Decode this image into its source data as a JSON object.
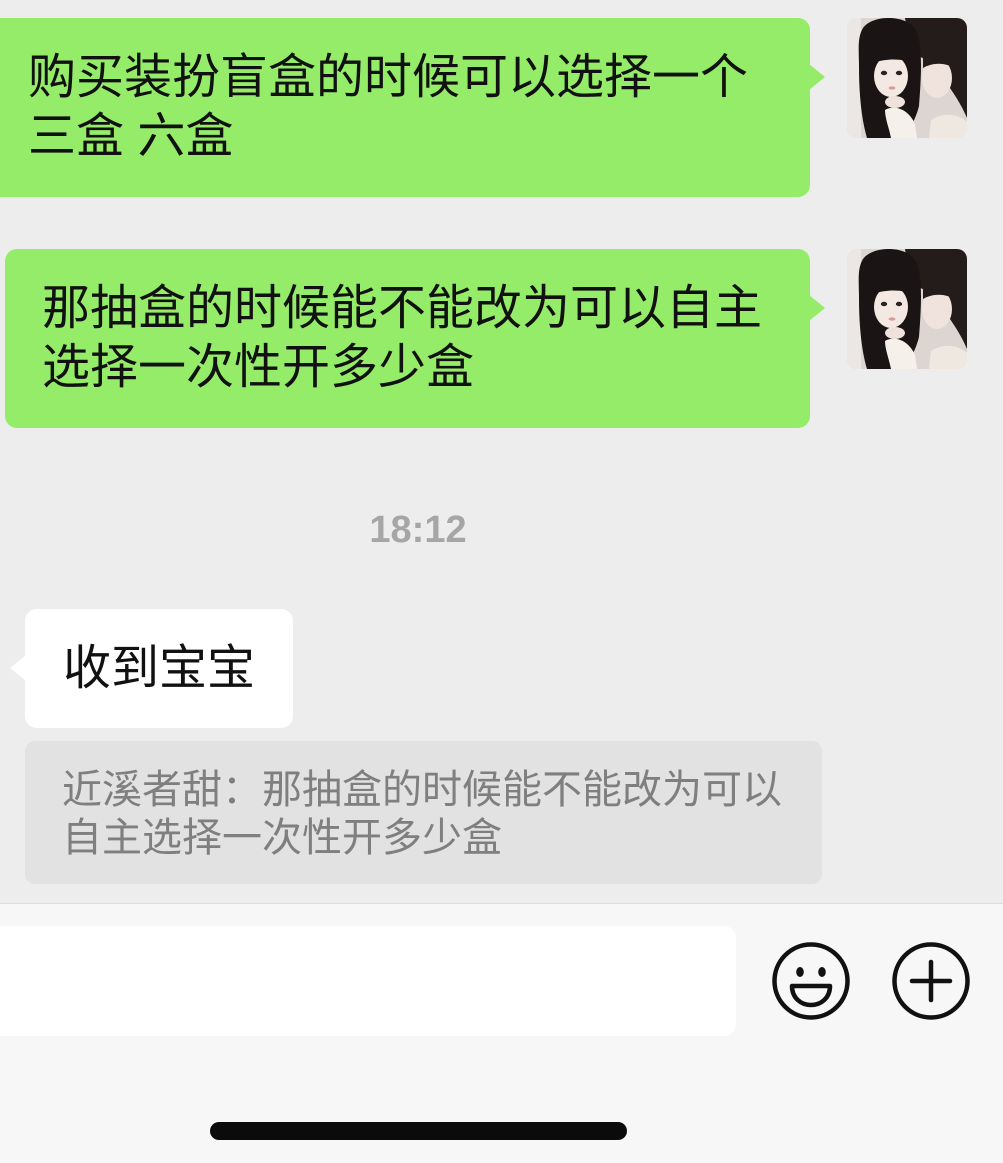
{
  "chat": {
    "sent_messages": [
      {
        "text": "购买装扮盲盒的时候可以选择一个三盒 六盒"
      },
      {
        "text": "那抽盒的时候能不能改为可以自主选择一次性开多少盒"
      }
    ],
    "timestamp": "18:12",
    "received_messages": [
      {
        "text": "收到宝宝",
        "quote": "近溪者甜：那抽盒的时候能不能改为可以自主选择一次性开多少盒"
      }
    ]
  },
  "input_bar": {
    "value": "",
    "emoji_icon": "smiley-face-icon",
    "more_icon": "plus-circle-icon"
  },
  "colors": {
    "chat_bg": "#ededed",
    "sent_bubble": "#95ec69",
    "received_bubble": "#ffffff",
    "quote_bg": "#e2e2e2",
    "quote_text": "#7f7f7f",
    "timestamp_text": "#a6a6a6",
    "message_text": "#111111",
    "input_bar_bg": "#f7f7f7",
    "icon_stroke": "#111111"
  }
}
